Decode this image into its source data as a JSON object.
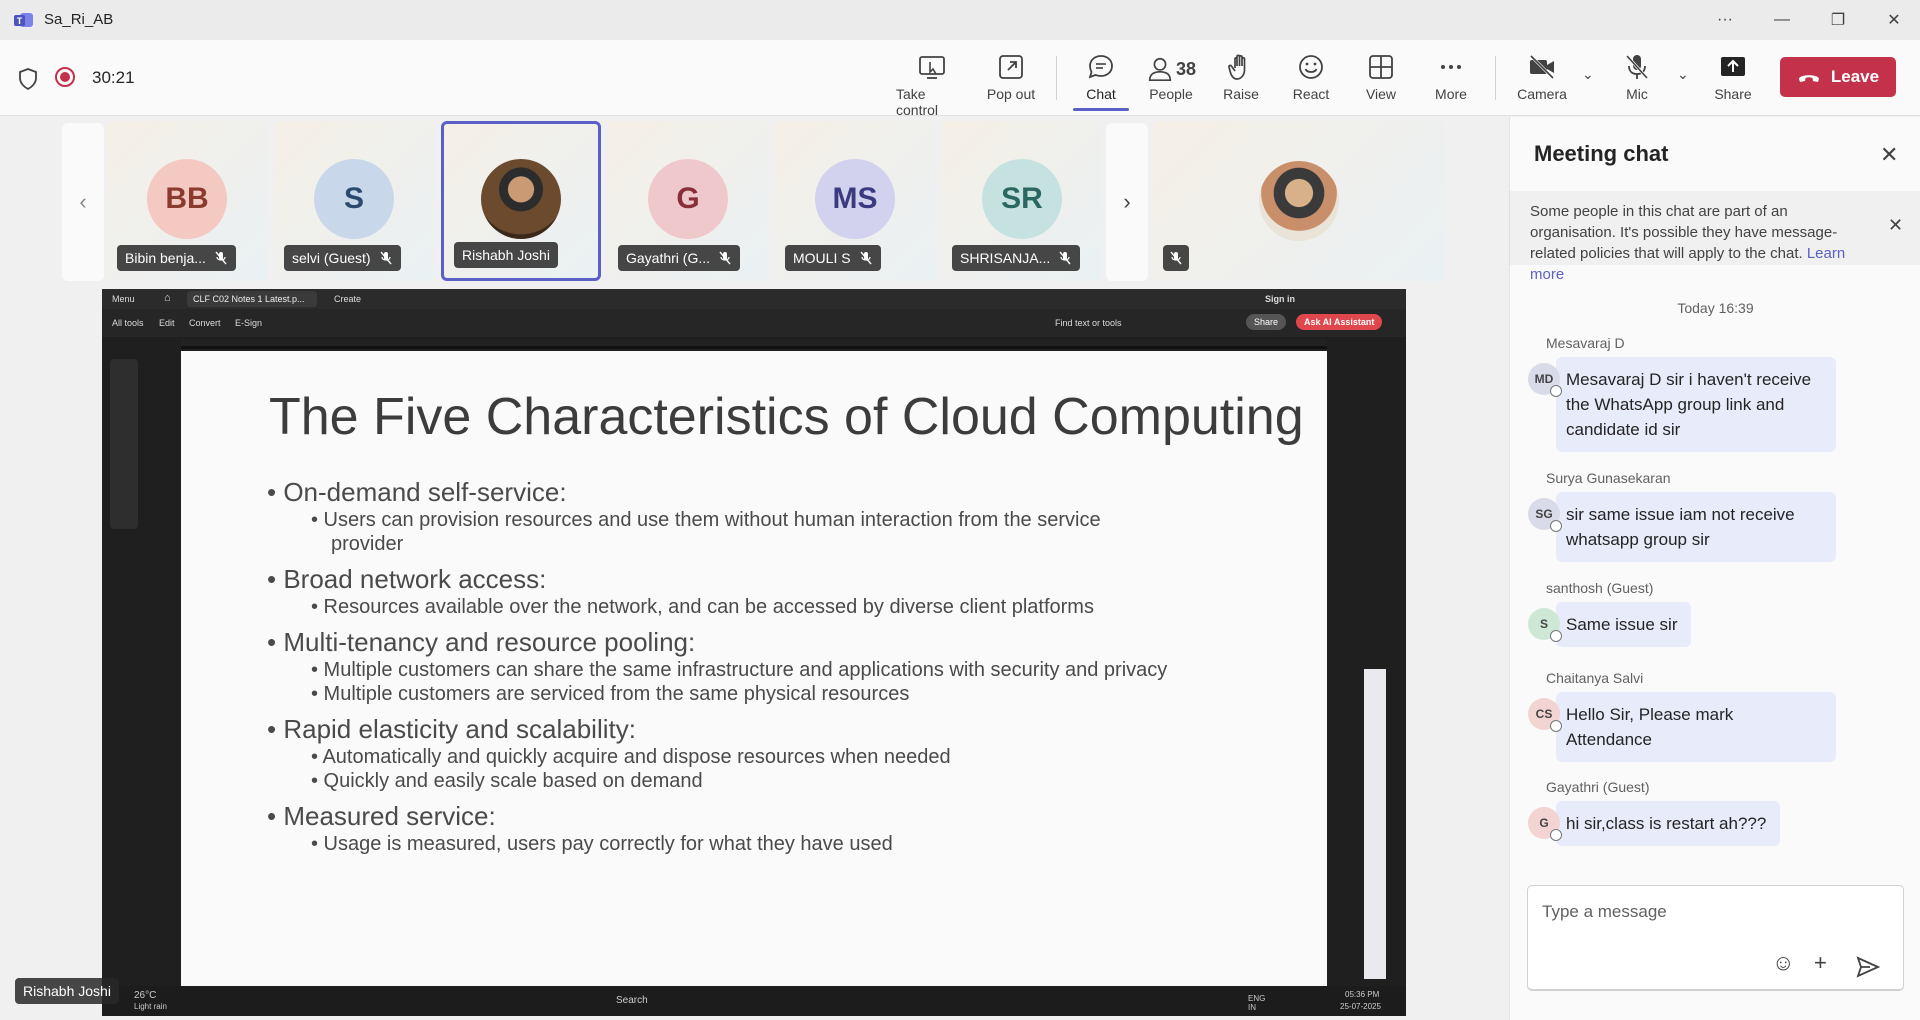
{
  "window": {
    "title": "Sa_Ri_AB"
  },
  "toolbar": {
    "timer": "30:21",
    "take_control": "Take control",
    "pop_out": "Pop out",
    "chat": "Chat",
    "people": "People",
    "people_count": "38",
    "raise": "Raise",
    "react": "React",
    "view": "View",
    "more": "More",
    "camera": "Camera",
    "mic": "Mic",
    "share": "Share",
    "leave": "Leave"
  },
  "participants": [
    {
      "initials": "BB",
      "name": "Bibin benja...",
      "color": "#f3c9c2",
      "text": "#8a3b2e"
    },
    {
      "initials": "S",
      "name": "selvi (Guest)",
      "color": "#c8d8ea",
      "text": "#2c4a6e"
    },
    {
      "initials": "",
      "name": "Rishabh Joshi",
      "color": "#6b4a2e",
      "text": "#fff"
    },
    {
      "initials": "G",
      "name": "Gayathri (G...",
      "color": "#efc8cc",
      "text": "#8a2f3a"
    },
    {
      "initials": "MS",
      "name": "MOULI S",
      "color": "#d3d2ee",
      "text": "#3b3a7e"
    },
    {
      "initials": "SR",
      "name": "SHRISANJA...",
      "color": "#c6e2e0",
      "text": "#2a6662"
    }
  ],
  "shared_screen": {
    "acrobat": {
      "menu": "Menu",
      "tab_title": "CLF C02 Notes 1 Latest.p...",
      "create": "Create",
      "sign_in": "Sign in",
      "all_tools": "All tools",
      "edit": "Edit",
      "convert": "Convert",
      "esign": "E-Sign",
      "find": "Find text or tools",
      "share_btn": "Share",
      "ai_assistant": "Ask AI Assistant"
    },
    "slide": {
      "title": "The Five Characteristics of Cloud Computing",
      "points": [
        {
          "heading": "On-demand self-service:",
          "subs": [
            "Users can provision resources and use them without human interaction from the service",
            "provider"
          ]
        },
        {
          "heading": "Broad network access:",
          "subs": [
            "Resources available over the network, and can be accessed by diverse client platforms"
          ]
        },
        {
          "heading": "Multi-tenancy and resource pooling:",
          "subs": [
            "Multiple customers can share the same infrastructure and applications with security and privacy",
            "Multiple customers are serviced from the same physical resources"
          ]
        },
        {
          "heading": "Rapid elasticity and scalability:",
          "subs": [
            "Automatically and quickly acquire and dispose resources when needed",
            "Quickly and easily scale based on demand"
          ]
        },
        {
          "heading": "Measured service:",
          "subs": [
            "Usage is measured, users pay correctly for what they have used"
          ]
        }
      ]
    },
    "taskbar": {
      "weather": "26°C",
      "weather_desc": "Light rain",
      "search": "Search",
      "lang": "ENG IN",
      "time": "05:36 PM",
      "date": "25-07-2025"
    },
    "presenter": "Rishabh Joshi"
  },
  "chat": {
    "title": "Meeting chat",
    "notice": "Some people in this chat are part of an organisation. It's possible they have message-related policies that will apply to the chat.",
    "learn_more": "Learn more",
    "date_separator": "Today 16:39",
    "messages": [
      {
        "sender": "Mesavaraj D",
        "initials": "MD",
        "color": "#d9dbe8",
        "text": "Mesavaraj D sir i haven't receive the WhatsApp group link and candidate id sir"
      },
      {
        "sender": "Surya Gunasekaran",
        "initials": "SG",
        "color": "#d9dbe8",
        "text": "sir same issue iam not receive whatsapp group sir"
      },
      {
        "sender": "santhosh (Guest)",
        "initials": "S",
        "color": "#cfe8d6",
        "text": "Same issue sir"
      },
      {
        "sender": "Chaitanya Salvi",
        "initials": "CS",
        "color": "#f2d4d2",
        "text": "Hello Sir,   Please mark Attendance"
      },
      {
        "sender": "Gayathri (Guest)",
        "initials": "G",
        "color": "#f2d4d2",
        "text": "hi sir,class is restart ah???"
      }
    ],
    "compose_placeholder": "Type a message"
  }
}
